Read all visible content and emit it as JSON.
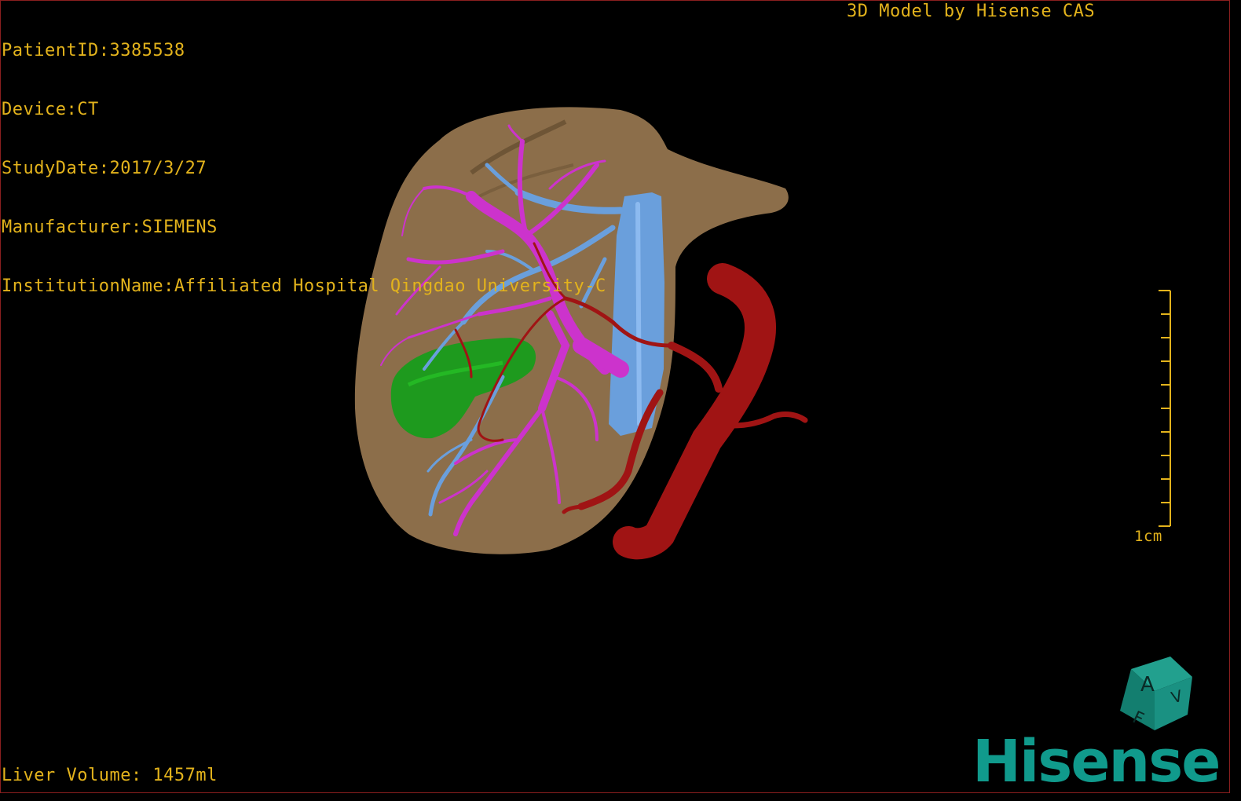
{
  "overlay": {
    "patient_id": "PatientID:3385538",
    "device": "Device:CT",
    "study_date": "StudyDate:2017/3/27",
    "manufacturer": "Manufacturer:SIEMENS",
    "institution": "InstitutionName:Affiliated Hospital Qingdao University-C",
    "model_by": "3D Model by Hisense CAS",
    "liver_volume": "Liver Volume: 1457ml"
  },
  "scale_bar": {
    "label": "1cm"
  },
  "orientation_cube": {
    "letters": [
      "A",
      "F",
      "V"
    ]
  },
  "brand": {
    "logo_text": "Hisense"
  },
  "colors": {
    "text": "#e3b31c",
    "liver": "#8c6e4a",
    "portal_vein": "#cc33cc",
    "hepatic_vein_ivc": "#6a9fdc",
    "artery": "#a01414",
    "gallbladder": "#1e9a1e",
    "brand": "#109a8c"
  }
}
